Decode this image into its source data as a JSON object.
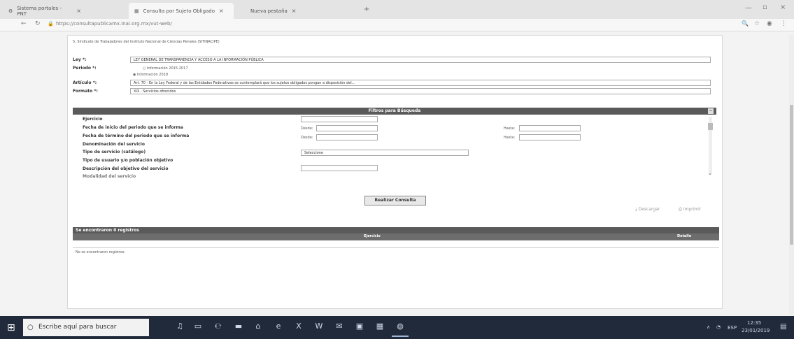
{
  "browser": {
    "tabs": [
      {
        "label": "Sistema portales - PNT"
      },
      {
        "label": "Consulta por Sujeto Obligado"
      },
      {
        "label": "Nueva pestaña"
      }
    ],
    "url": "https://consultapublicamx.inai.org.mx/vut-web/"
  },
  "form": {
    "subject": "5. Sindicato de Trabajadores del Instituto Nacional de Ciencias Penales (SITINACIPE)",
    "ley_label": "Ley *:",
    "ley_value": "LEY GENERAL DE TRANSPARENCIA Y ACCESO A LA INFORMACIÓN PÚBLICA",
    "periodo_label": "Periodo *:",
    "periodo_option1": "Información 2015-2017",
    "periodo_option2": "Información 2018",
    "articulo_label": "Artículo *:",
    "articulo_value": "Art. 70 - En la Ley Federal y de las Entidades Federativas se contemplará que los sujetos obligados pongan a disposición del...",
    "formato_label": "Formato *:",
    "formato_value": "XIX - Servicios ofrecidos"
  },
  "filters": {
    "title": "Filtros para Búsqueda",
    "rows": [
      "Ejercicio",
      "Fecha de inicio del periodo que se informa",
      "Fecha de término del periodo que se informa",
      "Denominación del servicio",
      "Tipo de servicio (catálogo)",
      "Tipo de usuario y/o población objetivo",
      "Descripción del objetivo del servicio",
      "Modalidad del servicio"
    ],
    "desde": "Desde:",
    "hasta": "Hasta:",
    "select_placeholder": "Seleccione"
  },
  "actions": {
    "consultar": "Realizar Consulta",
    "descargar": "Descargar",
    "imprimir": "Imprimir"
  },
  "results": {
    "title": "Se encontraron 0 registros",
    "col1": "Ejercicio",
    "col2": "Detalle",
    "empty": "No se encontraron registros."
  },
  "taskbar": {
    "search_placeholder": "Escribe aquí para buscar",
    "lang": "ESP",
    "time": "12:35",
    "date": "23/01/2019"
  }
}
